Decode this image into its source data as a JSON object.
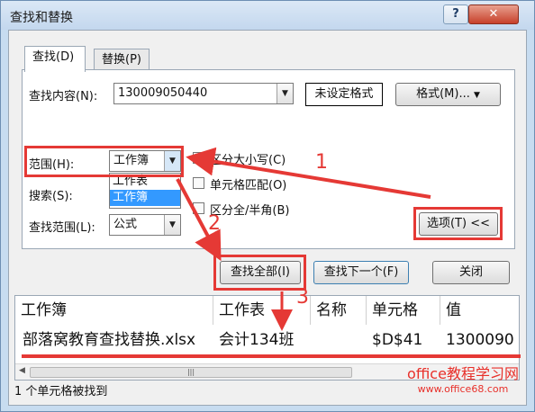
{
  "window": {
    "title": "查找和替换",
    "help_label": "?",
    "close_label": "✕"
  },
  "tabs": [
    {
      "label": "查找(D)"
    },
    {
      "label": "替换(P)"
    }
  ],
  "find": {
    "label": "查找内容(N):",
    "value": "130009050440",
    "no_format_label": "未设定格式",
    "format_button": "格式(M)..."
  },
  "options": {
    "scope_label": "范围(H):",
    "scope_value": "工作簿",
    "scope_options": [
      "工作表",
      "工作簿"
    ],
    "search_label": "搜索(S):",
    "lookin_label": "查找范围(L):",
    "lookin_value": "公式",
    "match_case": "区分大小写(C)",
    "match_cell": "单元格匹配(O)",
    "match_width": "区分全/半角(B)",
    "options_button": "选项(T) <<"
  },
  "actions": {
    "find_all": "查找全部(I)",
    "find_next": "查找下一个(F)",
    "close": "关闭"
  },
  "results": {
    "headers": [
      "工作簿",
      "工作表",
      "名称",
      "单元格",
      "值"
    ],
    "rows": [
      [
        "部落窝教育查找替换.xlsx",
        "会计134班",
        "",
        "$D$41",
        "1300090"
      ]
    ]
  },
  "status": "1 个单元格被找到",
  "annotations": {
    "num1": "1",
    "num2": "2",
    "num3": "3",
    "color": "#e53935"
  },
  "watermark": {
    "main": "office教程学习网",
    "url": "www.office68.com"
  }
}
